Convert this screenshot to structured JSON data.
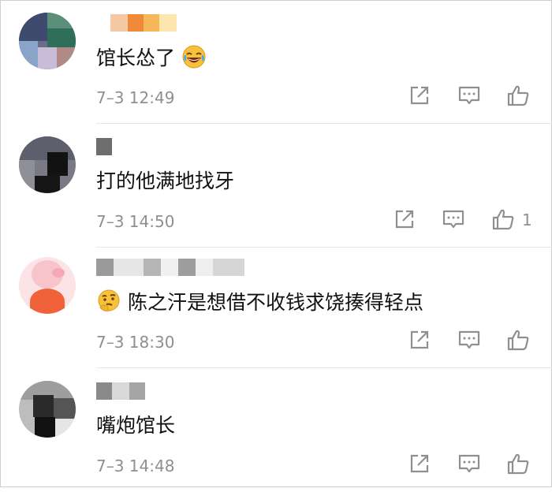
{
  "comments": [
    {
      "text": "馆长怂了",
      "emoji": "tears-of-joy-emoji",
      "emoji_position": "after",
      "time": "7–3 12:49",
      "likes": ""
    },
    {
      "text": "打的他满地找牙",
      "emoji": "",
      "emoji_position": "",
      "time": "7–3 14:50",
      "likes": "1"
    },
    {
      "text": "陈之汗是想借不收钱求饶揍得轻点",
      "emoji": "thinking-face-emoji",
      "emoji_position": "before",
      "time": "7–3 18:30",
      "likes": ""
    },
    {
      "text": "嘴炮馆长",
      "emoji": "",
      "emoji_position": "",
      "time": "7–3 14:48",
      "likes": ""
    }
  ],
  "icons": {
    "share": "share-icon",
    "reply": "reply-icon",
    "like": "thumbs-up-icon"
  },
  "colors": {
    "text": "#111111",
    "meta": "#8f8f8f",
    "icon": "#8f8f8f",
    "divider": "#e6e6e6"
  }
}
